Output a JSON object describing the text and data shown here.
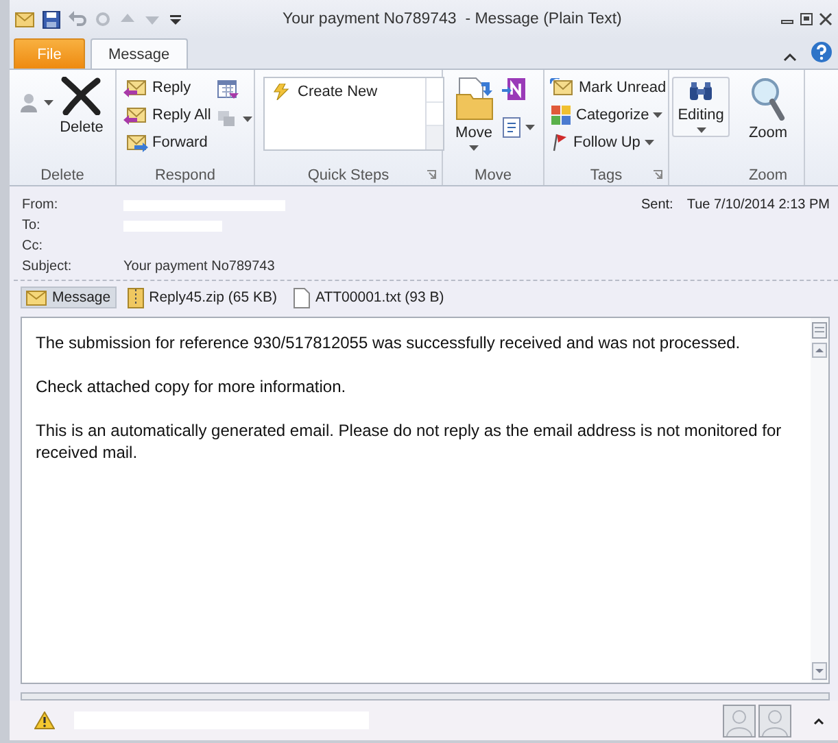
{
  "window": {
    "title": "Your payment No789743  - Message (Plain Text)"
  },
  "tabs": [
    {
      "label": "File",
      "kind": "file",
      "selected": false
    },
    {
      "label": "Message",
      "kind": "tab",
      "selected": true
    }
  ],
  "ribbon": {
    "groups": [
      {
        "label": "Delete",
        "items": [
          {
            "kind": "icon",
            "dropdown": true
          },
          {
            "kind": "large",
            "label": "Delete",
            "dropdown": false
          }
        ]
      },
      {
        "label": "Respond",
        "items": [
          {
            "kind": "small",
            "label": "Reply",
            "dropdown": false
          },
          {
            "kind": "small",
            "label": "Reply All",
            "dropdown": false
          },
          {
            "kind": "small",
            "label": "Forward",
            "dropdown": false
          },
          {
            "kind": "icon",
            "dropdown": false
          },
          {
            "kind": "icon",
            "dropdown": true
          }
        ]
      },
      {
        "label": "Quick Steps",
        "items": [
          {
            "kind": "gallery",
            "label": "Create New"
          }
        ]
      },
      {
        "label": "Move",
        "items": [
          {
            "kind": "large",
            "label": "Move",
            "dropdown": true
          },
          {
            "kind": "icon",
            "dropdown": false
          },
          {
            "kind": "icon",
            "dropdown": true
          }
        ]
      },
      {
        "label": "Tags",
        "items": [
          {
            "kind": "small",
            "label": "Mark Unread",
            "dropdown": false
          },
          {
            "kind": "small",
            "label": "Categorize",
            "dropdown": true
          },
          {
            "kind": "small",
            "label": "Follow Up",
            "dropdown": true
          }
        ]
      },
      {
        "items": [
          {
            "kind": "large",
            "label": "Editing",
            "dropdown": true
          }
        ]
      },
      {
        "label": "Zoom",
        "items": [
          {
            "kind": "large",
            "label": "Zoom",
            "dropdown": false
          }
        ]
      }
    ]
  },
  "header": {
    "fields": [
      {
        "label": "From:"
      },
      {
        "label": "To:"
      },
      {
        "label": "Cc:"
      },
      {
        "label": "Subject:",
        "value": "Your payment No789743"
      }
    ],
    "sent_label": "Sent:",
    "sent_value": "Tue 7/10/2014 2:13 PM"
  },
  "attachments": [
    {
      "kind": "message",
      "label": "Message",
      "selected": true
    },
    {
      "kind": "zip",
      "label": "Reply45.zip (65 KB)",
      "selected": false
    },
    {
      "kind": "txt",
      "label": "ATT00001.txt (93 B)",
      "selected": false
    }
  ],
  "body": [
    "The submission for reference 930/517812055 was successfully received and was not processed.",
    "Check attached copy for more information.",
    "This is an automatically generated email. Please do not reply as the email address is not monitored for received mail."
  ]
}
